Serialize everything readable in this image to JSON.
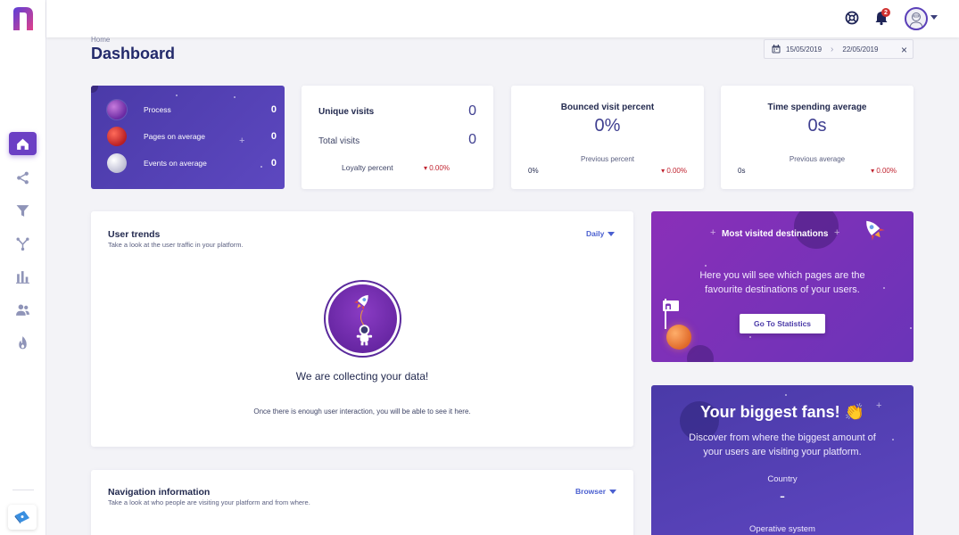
{
  "topbar": {
    "notification_count": "2"
  },
  "header": {
    "breadcrumb": "Home",
    "title": "Dashboard",
    "date_start": "15/05/2019",
    "date_end": "22/05/2019"
  },
  "summary": {
    "items": [
      {
        "label": "Process",
        "value": "0"
      },
      {
        "label": "Pages on average",
        "value": "0"
      },
      {
        "label": "Events on average",
        "value": "0"
      }
    ]
  },
  "visits": {
    "unique_label": "Unique visits",
    "unique_value": "0",
    "total_label": "Total visits",
    "total_value": "0",
    "loyalty_label": "Loyalty percent",
    "loyalty_delta": "0.00%"
  },
  "bounced": {
    "title": "Bounced visit percent",
    "value": "0%",
    "previous_label": "Previous percent",
    "previous_value": "0%",
    "delta": "0.00%"
  },
  "time_spending": {
    "title": "Time spending average",
    "value": "0s",
    "previous_label": "Previous average",
    "previous_value": "0s",
    "delta": "0.00%"
  },
  "user_trends": {
    "title": "User trends",
    "subtitle": "Take a look at the user traffic in your platform.",
    "filter": "Daily",
    "empty_title": "We are collecting your data!",
    "empty_text": "Once there is enough user interaction, you will be able to see it here."
  },
  "destinations": {
    "title": "Most visited destinations",
    "text": "Here you will see which pages are the favourite destinations of your users.",
    "button": "Go To Statistics"
  },
  "fans": {
    "title": "Your biggest fans! 👏",
    "text": "Discover from where the biggest amount of your users are visiting your platform.",
    "country_label": "Country",
    "country_value": "-",
    "os_label": "Operative system"
  },
  "navigation_info": {
    "title": "Navigation information",
    "subtitle": "Take a look at who people are visiting your platform and from where.",
    "filter": "Browser"
  },
  "colors": {
    "accent": "#6b3fc4",
    "card_purple": "#4a3aa8",
    "destinations_bg": "#7a32b8",
    "negative": "#c0232f"
  }
}
